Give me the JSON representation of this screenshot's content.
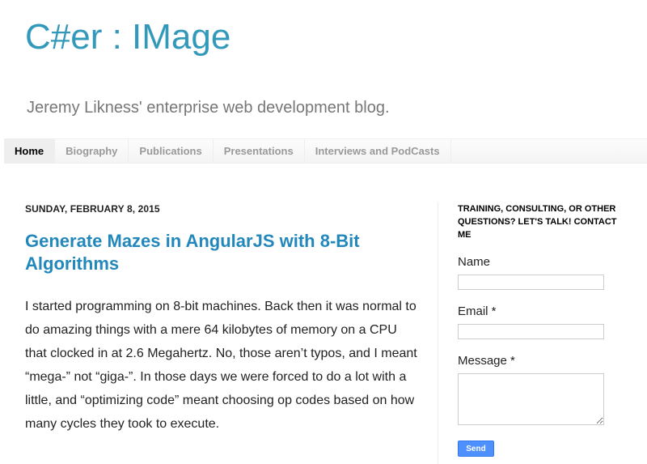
{
  "header": {
    "title": "C#er : IMage",
    "description": "Jeremy Likness' enterprise web development blog."
  },
  "tabs": [
    {
      "label": "Home",
      "selected": true
    },
    {
      "label": "Biography",
      "selected": false
    },
    {
      "label": "Publications",
      "selected": false
    },
    {
      "label": "Presentations",
      "selected": false
    },
    {
      "label": "Interviews and PodCasts",
      "selected": false
    }
  ],
  "post": {
    "date": "SUNDAY, FEBRUARY 8, 2015",
    "title": "Generate Mazes in AngularJS with 8-Bit Algorithms",
    "body": "I started programming on 8-bit machines. Back then it was normal to do amazing things with a mere 64 kilobytes of memory on a CPU that clocked in at 2.6 Megahertz. No, those aren’t typos, and I meant “mega-” not “giga-”. In those days we were forced to do a lot with a little, and “optimizing code” meant choosing op codes based on how many cycles they took to execute."
  },
  "sidebar": {
    "widget_title": "TRAINING, CONSULTING, OR OTHER QUESTIONS? LET'S TALK! CONTACT ME",
    "contact_form": {
      "name_label": "Name",
      "name_value": "",
      "email_label": "Email *",
      "email_value": "",
      "message_label": "Message *",
      "message_value": "",
      "send_label": "Send"
    }
  },
  "colors": {
    "title": "#3399bb",
    "post_title": "#2288bb",
    "send_button": "#4d90fe"
  }
}
